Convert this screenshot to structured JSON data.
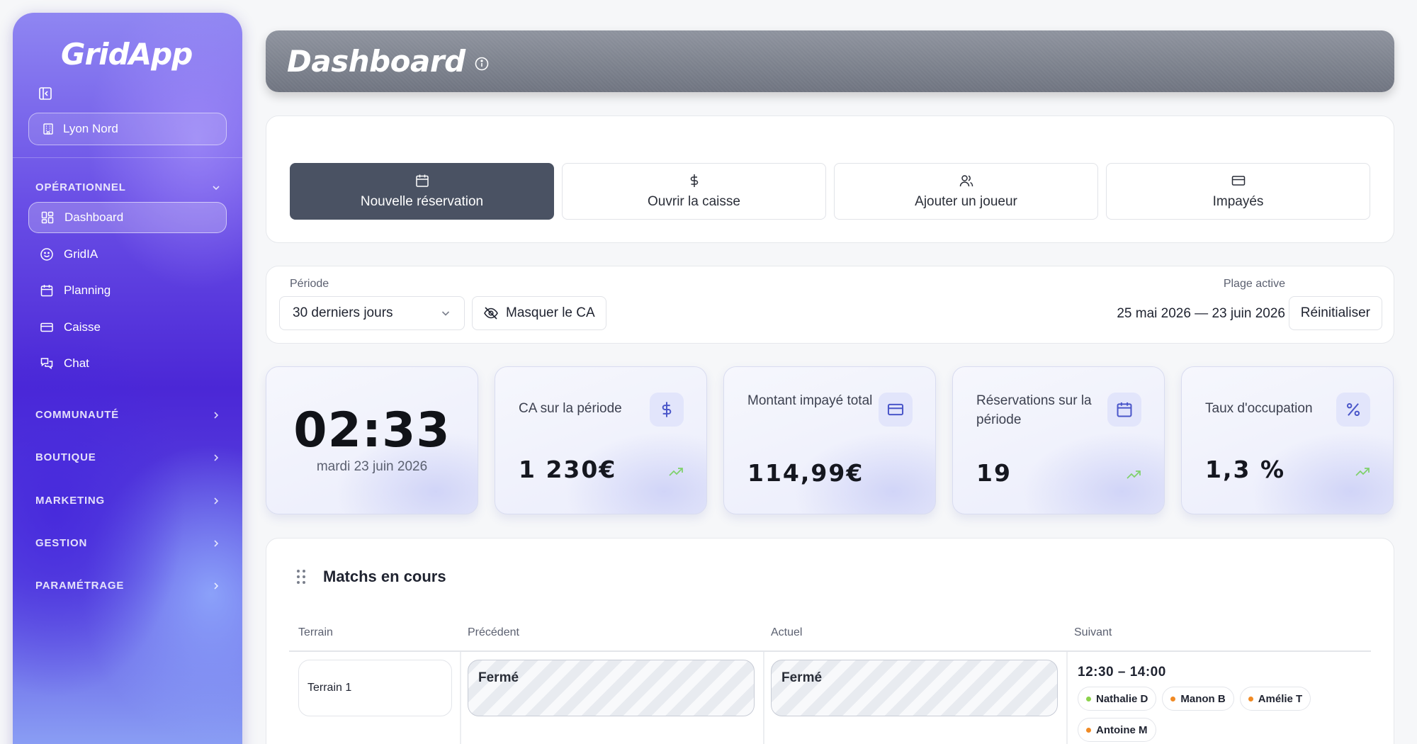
{
  "sidebar": {
    "logo": "GridApp",
    "site": "Lyon Nord",
    "sections": {
      "operationnel": "OPÉRATIONNEL",
      "communaute": "COMMUNAUTÉ",
      "boutique": "BOUTIQUE",
      "marketing": "MARKETING",
      "gestion": "GESTION",
      "parametrage": "PARAMÉTRAGE"
    },
    "items": [
      {
        "label": "Dashboard",
        "icon": "grid-icon"
      },
      {
        "label": "GridIA",
        "icon": "smile-icon"
      },
      {
        "label": "Planning",
        "icon": "calendar-icon"
      },
      {
        "label": "Caisse",
        "icon": "credit-card-icon"
      },
      {
        "label": "Chat",
        "icon": "chat-icon"
      }
    ]
  },
  "header": {
    "title": "Dashboard"
  },
  "actions": [
    {
      "label": "Nouvelle réservation",
      "icon": "calendar-icon"
    },
    {
      "label": "Ouvrir la caisse",
      "icon": "dollar-icon"
    },
    {
      "label": "Ajouter un joueur",
      "icon": "users-icon"
    },
    {
      "label": "Impayés",
      "icon": "credit-card-icon"
    }
  ],
  "filters": {
    "period_label": "Période",
    "period_value": "30 derniers jours",
    "mask_label": "Masquer le CA",
    "range_label": "Plage active",
    "range_value": "25 mai 2026 — 23 juin 2026",
    "reset_label": "Réinitialiser"
  },
  "clock": {
    "time": "02:33",
    "date": "mardi 23 juin 2026"
  },
  "kpis": [
    {
      "title": "CA sur la période",
      "value": "1 230€",
      "icon": "dollar-icon"
    },
    {
      "title": "Montant impayé total",
      "value": "114,99€",
      "icon": "credit-card-icon"
    },
    {
      "title": "Réservations sur la période",
      "value": "19",
      "icon": "calendar-icon"
    },
    {
      "title": "Taux d'occupation",
      "value": "1,3 %",
      "icon": "percent-icon"
    }
  ],
  "matches": {
    "title": "Matchs en cours",
    "columns": [
      "Terrain",
      "Précédent",
      "Actuel",
      "Suivant"
    ],
    "rows": [
      {
        "terrain": "Terrain 1",
        "previous": "Fermé",
        "current": "Fermé",
        "next_time": "12:30 – 14:00",
        "players": [
          {
            "name": "Nathalie D",
            "color": "#8bd24a"
          },
          {
            "name": "Manon B",
            "color": "#f08a24"
          },
          {
            "name": "Amélie T",
            "color": "#f08a24"
          },
          {
            "name": "Antoine M",
            "color": "#f08a24"
          }
        ]
      }
    ]
  },
  "colors": {
    "accent": "#4a5263",
    "trend": "#7fd16b",
    "kpi_icon": "#4a56c9"
  }
}
